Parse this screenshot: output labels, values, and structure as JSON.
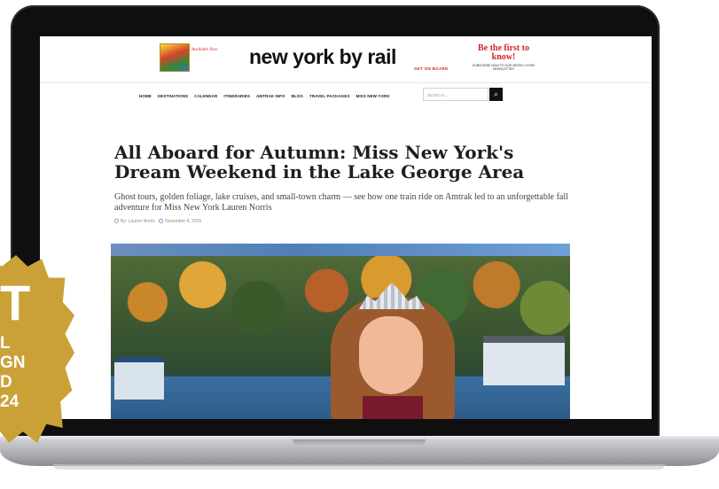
{
  "site": {
    "logo": "new york by rail",
    "logo_tagline": "GET ON BOARD",
    "promo_label": "Available Now",
    "subscribe_headline": "Be the first to know!",
    "subscribe_sub": "SUBSCRIBE NOW TO OUR WEEKLY NYBR NEWSLETTER"
  },
  "nav": [
    "HOME",
    "DESTINATIONS",
    "CALENDAR",
    "ITINERARIES",
    "AMTRAK INFO",
    "BLOG",
    "TRAVEL PACKAGES",
    "MISS NEW YORK"
  ],
  "search": {
    "placeholder": "SEARCH..."
  },
  "article": {
    "title": "All Aboard for Autumn: Miss New York's Dream Weekend in the Lake George Area",
    "deck": "Ghost tours, golden foliage, lake cruises, and small-town charm — see how one train ride on Amtrak led to an unforgettable fall adventure for Miss New York Lauren Norris",
    "author": "By: Lauren Norris",
    "date": "November 4, 2025"
  },
  "badge": {
    "big": "T",
    "lines": [
      "L",
      "GN",
      "D",
      "24"
    ]
  },
  "colors": {
    "brand_red": "#d2232a",
    "badge_gold": "#caa137"
  }
}
